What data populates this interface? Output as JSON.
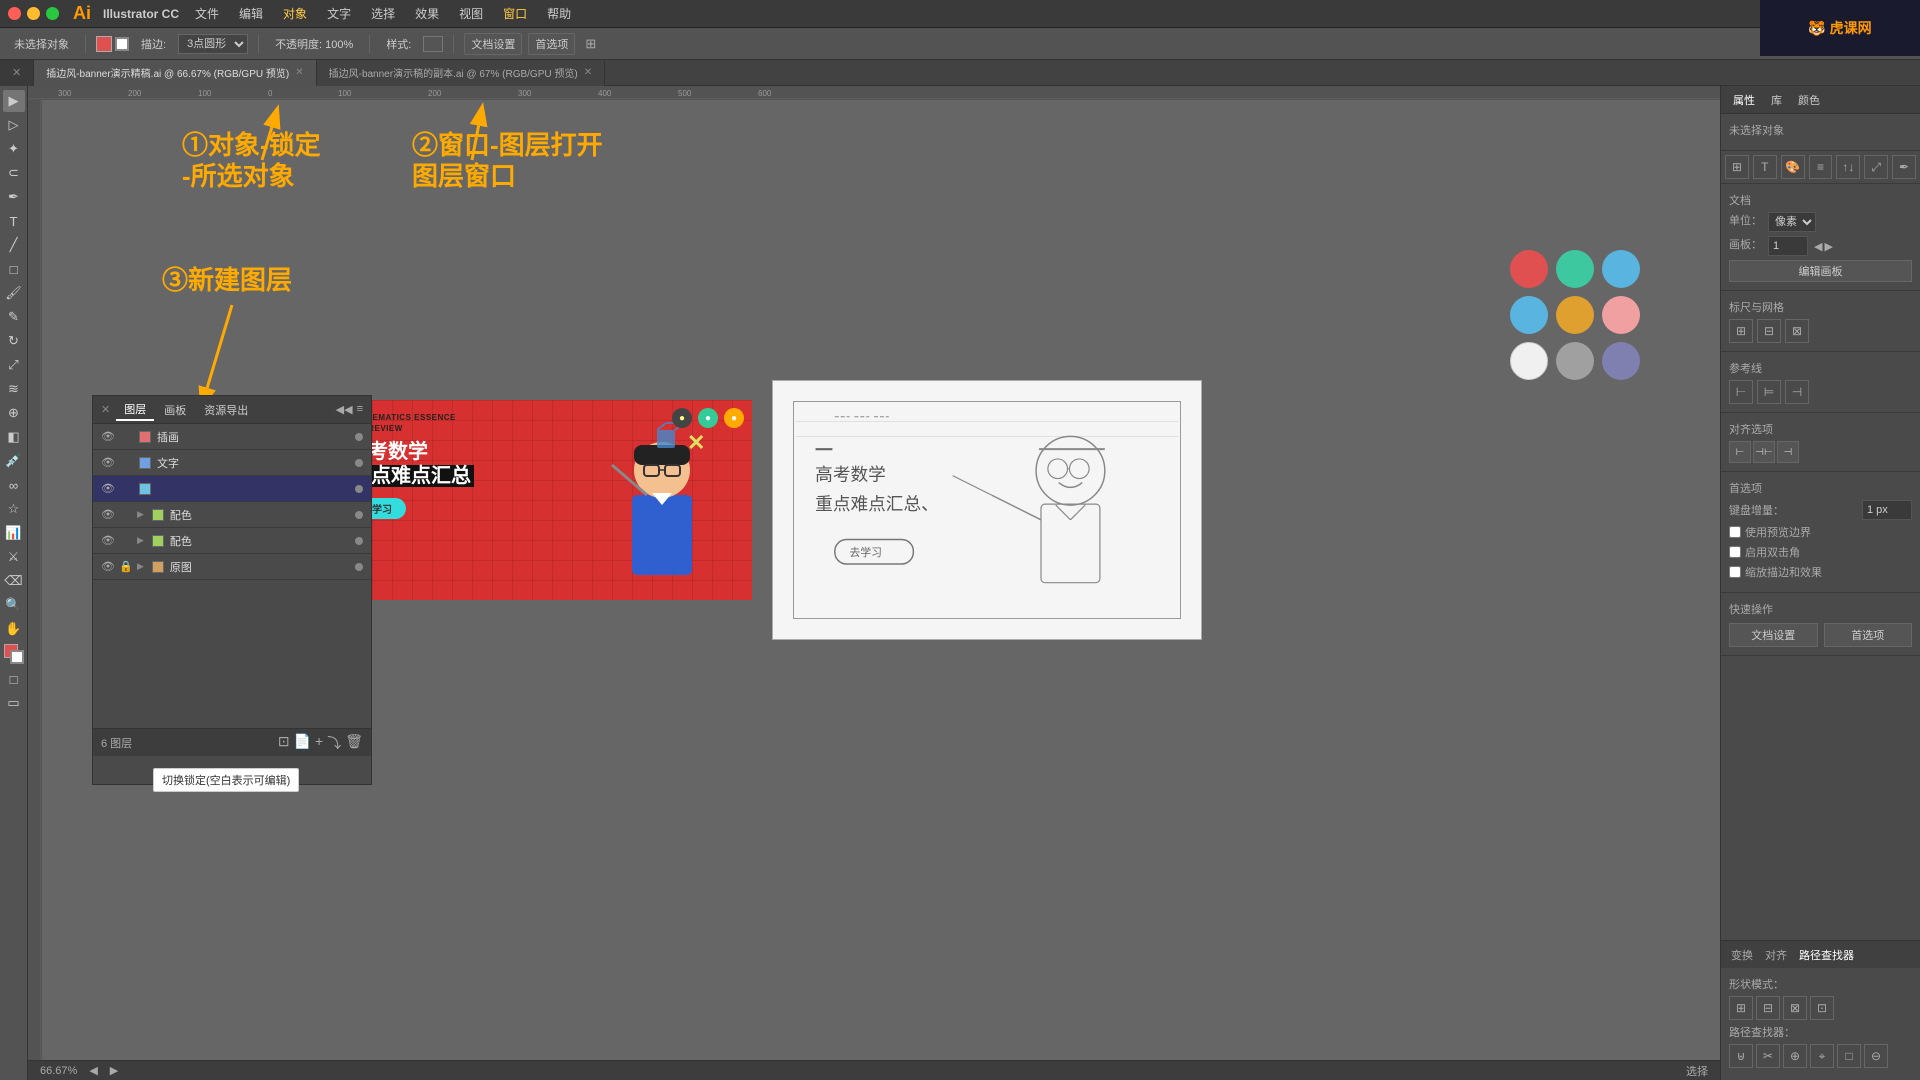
{
  "app": {
    "name": "Illustrator CC",
    "logo": "Ai",
    "version": "66.67%"
  },
  "menubar": {
    "traffic": [
      "red",
      "yellow",
      "green"
    ],
    "items": [
      "文件",
      "编辑",
      "对象",
      "文字",
      "选择",
      "效果",
      "视图",
      "窗口",
      "帮助"
    ]
  },
  "toolbar": {
    "no_selection": "未选择对象",
    "stroke": "描边:",
    "shape": "3点圆形",
    "opacity": "不透明度: 100%",
    "style": "样式:",
    "doc_settings": "文档设置",
    "preferences": "首选项"
  },
  "tabs": [
    {
      "label": "插边风-banner演示精稿.ai @ 66.67% (RGB/GPU 预览)",
      "active": true
    },
    {
      "label": "插边风-banner演示稿的副本.ai @ 67% (RGB/GPU 预览)",
      "active": false
    }
  ],
  "annotations": {
    "anno1": "①对象-锁定",
    "anno1b": "-所选对象",
    "anno2": "②窗口-图层打开",
    "anno2b": "图层窗口",
    "anno3": "③新建图层"
  },
  "canvas": {
    "zoom": "66.67%",
    "mode": "选择"
  },
  "layer_panel": {
    "tabs": [
      "图层",
      "画板",
      "资源导出"
    ],
    "layers": [
      {
        "name": "插画",
        "visible": true,
        "locked": false,
        "color": "#e07070",
        "expanded": false,
        "count": null
      },
      {
        "name": "文字",
        "visible": true,
        "locked": false,
        "color": "#70a0e0",
        "expanded": false
      },
      {
        "name": "",
        "visible": true,
        "locked": false,
        "color": "#70c0e0",
        "expanded": false,
        "editing": true
      },
      {
        "name": "配色",
        "visible": true,
        "locked": false,
        "color": "#a0d060",
        "expanded": true,
        "sub": true
      },
      {
        "name": "配色",
        "visible": true,
        "locked": false,
        "color": "#a0d060",
        "expanded": false,
        "sub": false
      },
      {
        "name": "原图",
        "visible": true,
        "locked": true,
        "color": "#d0a060",
        "expanded": true,
        "sub": false
      }
    ],
    "layer_count": "6 图层",
    "tooltip": "切换锁定(空白表示可编辑)"
  },
  "right_panel": {
    "tabs": [
      "属性",
      "库",
      "颜色"
    ],
    "selection": "未选择对象",
    "doc_section": {
      "label": "文档",
      "unit_label": "单位：",
      "unit": "像素",
      "template_label": "画板：",
      "template_value": "1",
      "edit_template_btn": "编辑画板"
    },
    "grid_section": {
      "label": "标尺与网格"
    },
    "guides_section": {
      "label": "参考线"
    },
    "align_section": {
      "label": "对齐选项"
    },
    "snap_section": {
      "label": "首选项",
      "keyboard_increment": "键盘增量：",
      "keyboard_value": "1 px",
      "use_preview_bounds": "使用预览边界",
      "double_click_corner": "启用双击角",
      "scale_corners": "缩放描边和效果"
    },
    "quick_actions": {
      "label": "快速操作",
      "doc_settings": "文档设置",
      "preferences": "首选项"
    },
    "bottom_tabs": [
      "变换",
      "对齐",
      "路径查找器"
    ],
    "shape_modes_label": "形状模式：",
    "pathfinder_label": "路径查找器："
  },
  "color_swatches": [
    "#e05050",
    "#3ec8a0",
    "#5ab4e0",
    "#5ab4e0",
    "#e0a030",
    "#f0a0a0",
    "#f0f0f0",
    "#a0a0a0",
    "#8080b0"
  ],
  "banner": {
    "eng_line1": "MATHEMATICS ESSENCE",
    "eng_line2": "THE REVIEW",
    "cn_title_line1": "高考数学",
    "cn_title_line2": "重点难点汇总",
    "button": "去学习"
  },
  "logo_brand": "虎课网",
  "statusbar": {
    "zoom": "66.67%",
    "mode": "选择"
  }
}
